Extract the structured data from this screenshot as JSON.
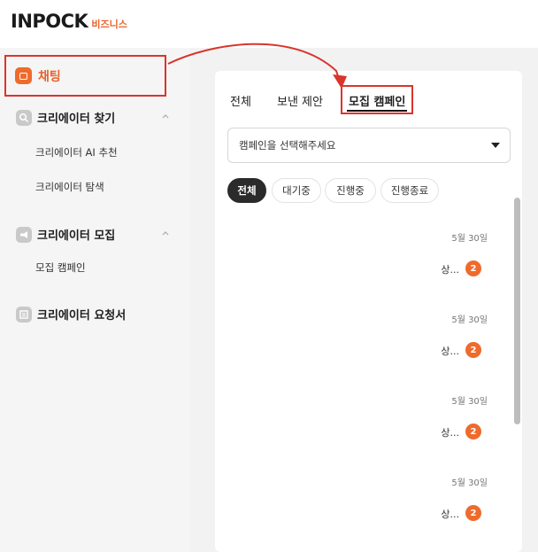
{
  "brand": {
    "name": "INPOCK",
    "sub": "비즈니스"
  },
  "sidebar": {
    "chat": {
      "label": "채팅"
    },
    "find": {
      "title": "크리에이터 찾기",
      "items": [
        "크리에이터 AI 추천",
        "크리에이터 탐색"
      ]
    },
    "recruit": {
      "title": "크리에이터 모집",
      "items": [
        "모집 캠페인"
      ]
    },
    "request": {
      "title": "크리에이터 요청서"
    }
  },
  "tabs": [
    "전체",
    "보낸 제안",
    "모집 캠페인"
  ],
  "select": {
    "placeholder": "캠페인을 선택해주세요"
  },
  "filters": [
    "전체",
    "대기중",
    "진행중",
    "진행종료"
  ],
  "list": [
    {
      "date": "5월 30일",
      "name": "상...",
      "count": "2"
    },
    {
      "date": "5월 30일",
      "name": "상...",
      "count": "2"
    },
    {
      "date": "5월 30일",
      "name": "상...",
      "count": "2"
    },
    {
      "date": "5월 30일",
      "name": "상...",
      "count": "2"
    }
  ],
  "colors": {
    "accent": "#ee6b2c",
    "annotation": "#d9352b"
  },
  "icons": {
    "chat": "chat-bubble-icon",
    "find": "search-icon",
    "recruit": "megaphone-icon",
    "request": "document-icon",
    "collapse": "chevron-up-icon",
    "dropdown": "caret-down-icon"
  }
}
